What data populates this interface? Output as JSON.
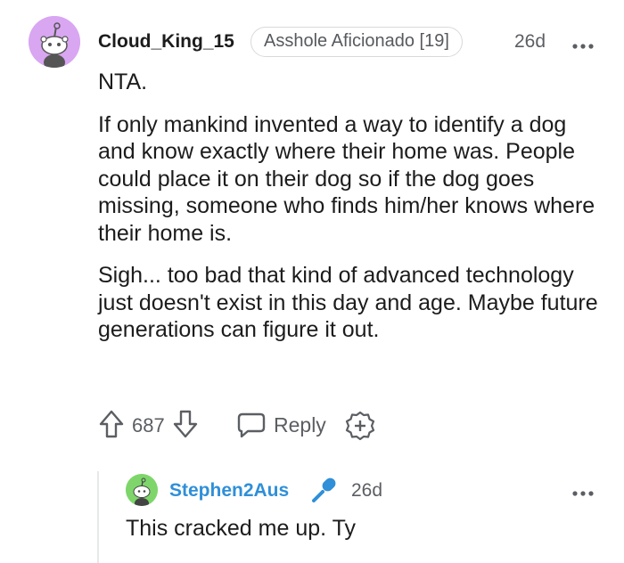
{
  "comment": {
    "username": "Cloud_King_15",
    "flair": "Asshole Aficionado [19]",
    "time": "26d",
    "paragraphs": [
      "NTA.",
      "If only mankind invented a way to identify a dog and know exactly where their home was. People could place it on their dog so if the dog goes missing, someone who finds him/her knows where their home is.",
      "Sigh... too bad that kind of advanced technology just doesn't exist in this day and age. Maybe future generations can figure it out."
    ],
    "votes": "687",
    "reply_label": "Reply",
    "avatar_color": "#d9a6f2"
  },
  "reply": {
    "username": "Stephen2Aus",
    "time": "26d",
    "text": "This cracked me up. Ty",
    "username_color": "#2f8fd8",
    "avatar_color": "#7ed66b"
  },
  "icons": [
    "more-icon",
    "upvote-icon",
    "downvote-icon",
    "reply-icon",
    "award-icon",
    "microphone-icon"
  ]
}
